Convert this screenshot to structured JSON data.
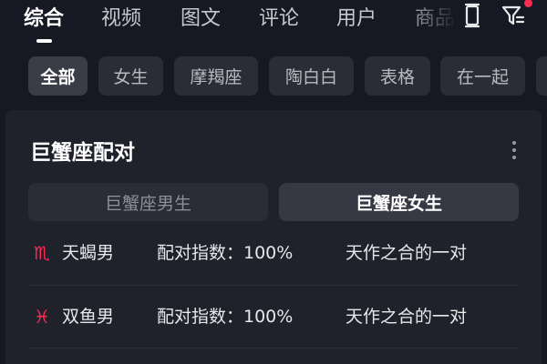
{
  "tabs": [
    {
      "label": "综合",
      "active": true
    },
    {
      "label": "视频"
    },
    {
      "label": "图文"
    },
    {
      "label": "评论"
    },
    {
      "label": "用户"
    },
    {
      "label": "商品"
    }
  ],
  "header_icons": [
    "tablet-icon",
    "filter-icon"
  ],
  "chips": [
    {
      "label": "全部",
      "active": true
    },
    {
      "label": "女生"
    },
    {
      "label": "摩羯座"
    },
    {
      "label": "陶白白"
    },
    {
      "label": "表格"
    },
    {
      "label": "在一起"
    }
  ],
  "card": {
    "title": "巨蟹座配对",
    "segments": [
      {
        "label": "巨蟹座男生",
        "active": false
      },
      {
        "label": "巨蟹座女生",
        "active": true
      }
    ],
    "rows": [
      {
        "sign": "♏",
        "name": "天蝎男",
        "score": "配对指数：100%",
        "desc": "天作之合的一对"
      },
      {
        "sign": "♓",
        "name": "双鱼男",
        "score": "配对指数：100%",
        "desc": "天作之合的一对"
      }
    ]
  },
  "colors": {
    "accent": "#fe2c55",
    "background": "#161823"
  }
}
